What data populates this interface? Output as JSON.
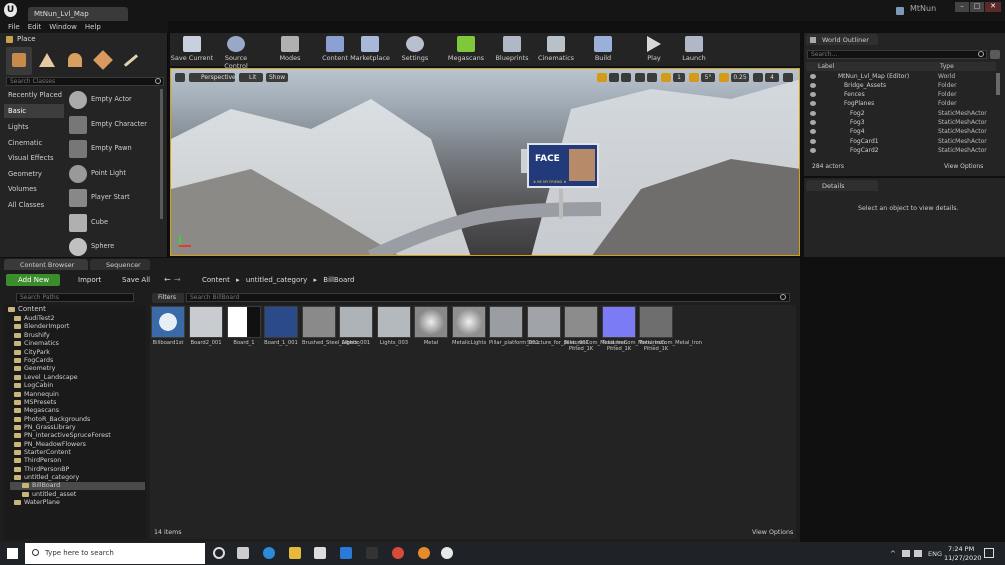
{
  "window": {
    "tab_title": "MtNun_Lvl_Map",
    "user_badge": "MtNun"
  },
  "menu": [
    "File",
    "Edit",
    "Window",
    "Help"
  ],
  "place": {
    "header": "Place",
    "search_placeholder": "Search Classes",
    "categories": [
      "Recently Placed",
      "Basic",
      "Lights",
      "Cinematic",
      "Visual Effects",
      "Geometry",
      "Volumes",
      "All Classes"
    ],
    "selected_category": "Basic",
    "items": [
      "Empty Actor",
      "Empty Character",
      "Empty Pawn",
      "Point Light",
      "Player Start",
      "Cube",
      "Sphere"
    ]
  },
  "toolbar": [
    "Save Current",
    "Source Control",
    "Modes",
    "Content",
    "Marketplace",
    "Settings",
    "Megascans",
    "Blueprints",
    "Cinematics",
    "Build",
    "Play",
    "Launch"
  ],
  "viewport": {
    "perspective": "Perspective",
    "lit": "Lit",
    "show": "Show",
    "grid_snap": "1",
    "rot_snap": "5°",
    "scale_snap": "0.25",
    "camera_speed": "4",
    "billboard_text": "FACE",
    "billboard_sub": "★ BE MY FRIEND ★"
  },
  "outliner": {
    "title": "World Outliner",
    "search_placeholder": "Search...",
    "col_label": "Label",
    "col_type": "Type",
    "rows": [
      {
        "label": "MtNun_Lvl_Map (Editor)",
        "type": "World",
        "indent": 0
      },
      {
        "label": "Bridge_Assets",
        "type": "Folder",
        "indent": 1
      },
      {
        "label": "Fences",
        "type": "Folder",
        "indent": 1
      },
      {
        "label": "FogPlanes",
        "type": "Folder",
        "indent": 1
      },
      {
        "label": "Fog2",
        "type": "StaticMeshActor",
        "indent": 2
      },
      {
        "label": "Fog3",
        "type": "StaticMeshActor",
        "indent": 2
      },
      {
        "label": "Fog4",
        "type": "StaticMeshActor",
        "indent": 2
      },
      {
        "label": "FogCard1",
        "type": "StaticMeshActor",
        "indent": 2
      },
      {
        "label": "FogCard2",
        "type": "StaticMeshActor",
        "indent": 2
      }
    ],
    "actor_count": "284 actors",
    "view_options": "View Options"
  },
  "details": {
    "title": "Details",
    "empty_text": "Select an object to view details."
  },
  "content_browser": {
    "tab": "Content Browser",
    "tab2": "Sequencer",
    "add_new": "Add New",
    "import": "Import",
    "save_all": "Save All",
    "breadcrumb": [
      "Content",
      "untitled_category",
      "BillBoard"
    ],
    "search_paths_placeholder": "Search Paths",
    "filters": "Filters",
    "search_placeholder": "Search BillBoard",
    "root": "Content",
    "folders": [
      "AudiTest2",
      "BlenderImport",
      "Brushify",
      "Cinematics",
      "CityPark",
      "FogCards",
      "Geometry",
      "Level_Landscape",
      "LogCabin",
      "Mannequin",
      "MSPresets",
      "Megascans",
      "PhotoR_Backgrounds",
      "PN_GrassLibrary",
      "PN_interactiveSpruceForest",
      "PN_MeadowFlowers",
      "StarterContent",
      "ThirdPerson",
      "ThirdPersonBP",
      "untitled_category",
      "BillBoard",
      "untitled_asset",
      "WaterPlane"
    ],
    "assets": [
      "Billboard1st",
      "Board2_001",
      "Board_1",
      "Board_1_001",
      "Brushed_Steel_Albedo",
      "Lights_001",
      "Lights_003",
      "Metal",
      "MetalicLights",
      "Pillar_platform_001",
      "Structure_for_pillar_001",
      "TexturesCom_Metal_Iron Pitted_1K",
      "TexturesCom_Metal_Iron Pitted_1K",
      "TexturesCom_Metal_Iron Pitted_1K"
    ],
    "item_count": "14 items",
    "view_options": "View Options"
  },
  "taskbar": {
    "search_placeholder": "Type here to search",
    "lang": "ENG",
    "time": "7:24 PM",
    "date": "11/27/2020"
  }
}
